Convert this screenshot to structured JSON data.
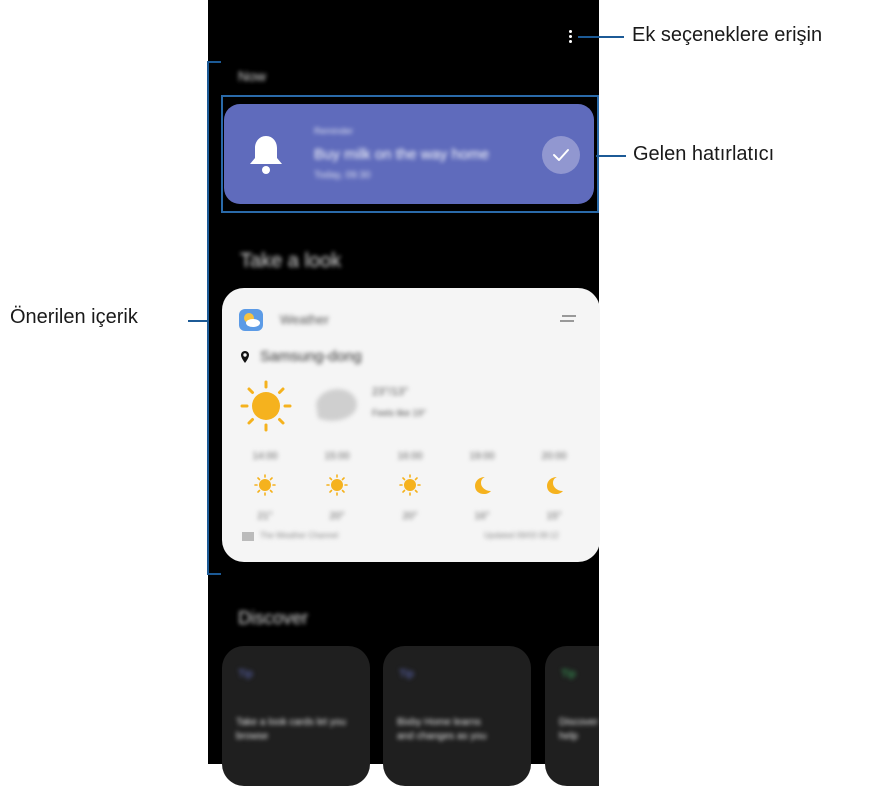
{
  "annotations": {
    "more_options": "Ek seçeneklere erişin",
    "incoming_reminder": "Gelen hatırlatıcı",
    "suggested_content": "Önerilen içerik"
  },
  "screen": {
    "section_now": "Now",
    "section_take_a_look": "Take a look",
    "section_discover": "Discover"
  },
  "reminder": {
    "app": "Reminder",
    "title": "Buy milk on the way home",
    "time": "Today, 09:30",
    "bell_icon": "bell-icon",
    "check_icon": "check-icon",
    "accent_color": "#5f6bbc"
  },
  "weather": {
    "header": "Weather",
    "location": "Samsung-dong",
    "temp_range": "23°/13°",
    "feels_like": "Feels like 19°",
    "hourly": [
      {
        "time": "14:00",
        "icon": "sun-icon",
        "temp": "21°"
      },
      {
        "time": "15:00",
        "icon": "sun-icon",
        "temp": "20°"
      },
      {
        "time": "16:00",
        "icon": "sun-icon",
        "temp": "20°"
      },
      {
        "time": "19:00",
        "icon": "moon-icon",
        "temp": "16°"
      },
      {
        "time": "20:00",
        "icon": "moon-icon",
        "temp": "15°"
      }
    ],
    "provider": "The Weather Channel",
    "updated": "Updated 09/03 09:12"
  },
  "discover": {
    "cards": [
      {
        "tag": "Tip",
        "body": "Take a look cards let you browse",
        "tag_color": "#5f6bbc"
      },
      {
        "tag": "Tip",
        "body": "Bixby Home learns and changes as you",
        "tag_color": "#5f6bbc"
      },
      {
        "tag": "Tip",
        "body": "Discover help",
        "tag_color": "#3aa35a"
      }
    ]
  }
}
